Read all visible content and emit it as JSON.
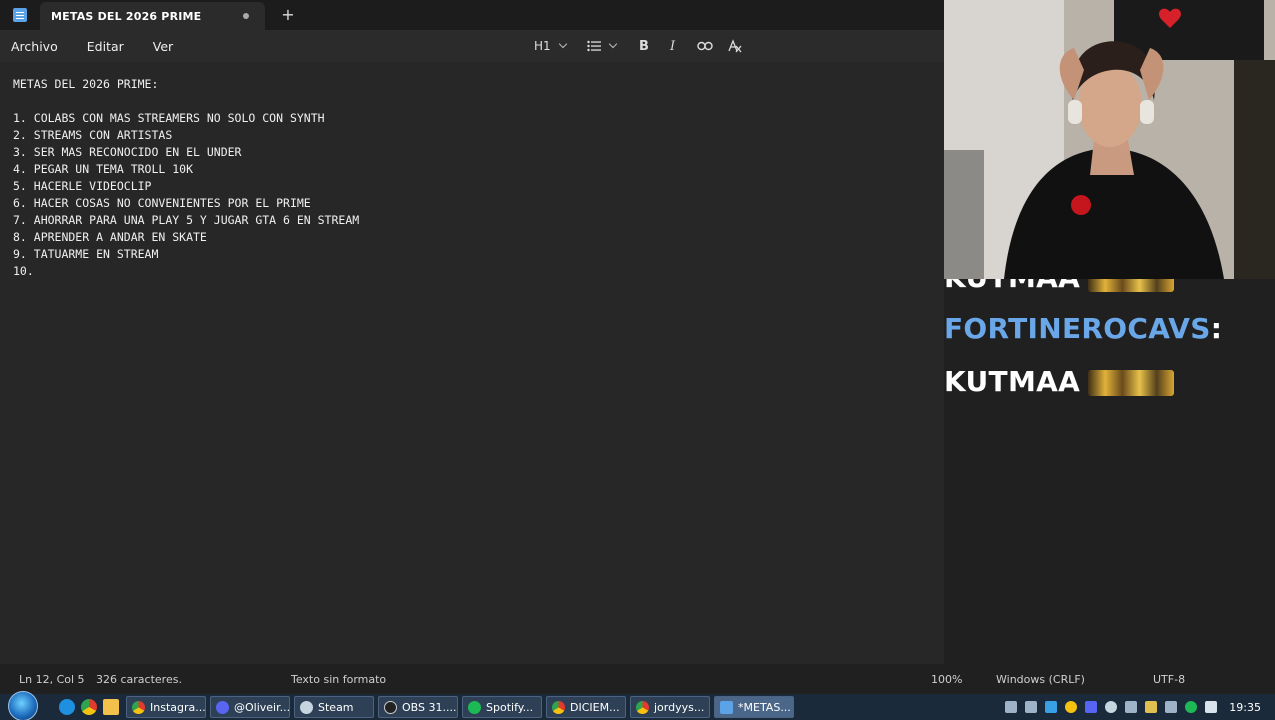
{
  "tab": {
    "title": "METAS DEL 2026 PRIME"
  },
  "menu": [
    "Archivo",
    "Editar",
    "Ver"
  ],
  "toolbar": {
    "heading": "H1"
  },
  "document": {
    "lines": [
      "METAS DEL 2026 PRIME:",
      "",
      "1. COLABS CON MAS STREAMERS NO SOLO CON SYNTH",
      "2. STREAMS CON ARTISTAS",
      "3. SER MAS RECONOCIDO EN EL UNDER",
      "4. PEGAR UN TEMA TROLL 10K",
      "5. HACERLE VIDEOCLIP",
      "6. HACER COSAS NO CONVENIENTES POR EL PRIME",
      "7. AHORRAR PARA UNA PLAY 5 Y JUGAR GTA 6 EN STREAM",
      "8. APRENDER A ANDAR EN SKATE",
      "9. TATUARME EN STREAM",
      "10."
    ]
  },
  "status": {
    "position": "Ln 12, Col 5",
    "chars": "326 caracteres.",
    "format": "Texto sin formato",
    "zoom": "100%",
    "line_endings": "Windows (CRLF)",
    "encoding": "UTF-8"
  },
  "chat": {
    "partial_top": "KUTMAA",
    "username": "FORTINEROCAVS",
    "colon": ":",
    "message": "KUTMAA",
    "username_color": "#6aa7e8"
  },
  "taskbar": {
    "items": [
      "Instagra...",
      "@Oliveir...",
      "Steam",
      "OBS 31....",
      "Spotify...",
      "DICIEM...",
      "jordyys...",
      "*METAS..."
    ],
    "clock": "19:35"
  }
}
